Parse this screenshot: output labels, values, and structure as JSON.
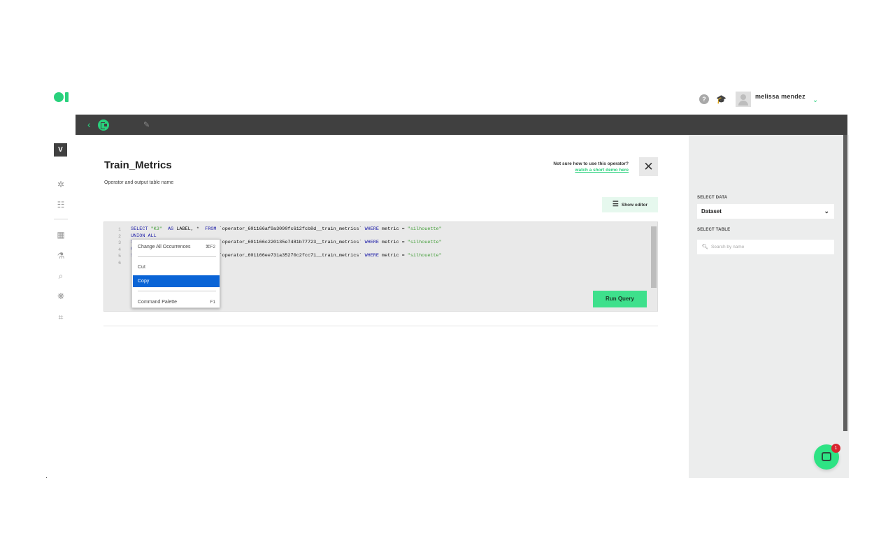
{
  "header": {
    "user_name": "melissa mendez",
    "icons": [
      "help-icon",
      "graduation-cap-icon",
      "avatar",
      "chevron-down-icon"
    ]
  },
  "sidebar": {
    "workspace_initial": "V",
    "items": [
      "flow-icon",
      "team-icon",
      "dashboard-icon",
      "experiments-icon",
      "analytics-icon",
      "models-icon",
      "code-icon"
    ]
  },
  "operator": {
    "title": "Train_Metrics",
    "subtitle": "Operator and output table name",
    "help_question": "Not sure how to use this operator?",
    "help_link": "watch a short demo here",
    "show_editor_label": "Show editor",
    "run_query_label": "Run Query"
  },
  "editor": {
    "line_numbers": [
      "1",
      "2",
      "3",
      "4",
      "5",
      "6"
    ],
    "lines": [
      "SELECT \"K3\"  AS LABEL, *  FROM `operator_601166af9a3090fc612fcb8d__train_metrics` WHERE metric = \"silhouette\"",
      "UNION ALL",
      "SELECT \"K4\"  AS LABEL, *  FROM `operator_601166c220135e7481b77723__train_metrics` WHERE metric = \"silhouette\"",
      "UNION ALL",
      "SELECT \"K5\"  AS LABEL, *  FROM `operator_601166ee731a35270c2fcc71__train_metrics` WHERE metric = \"silhouette\"",
      ""
    ]
  },
  "context_menu": {
    "items": [
      {
        "label": "Change All Occurrences",
        "shortcut": "⌘F2"
      },
      {
        "label": "Cut",
        "shortcut": ""
      },
      {
        "label": "Copy",
        "shortcut": ""
      },
      {
        "label": "Command Palette",
        "shortcut": "F1"
      }
    ],
    "selected": "Copy"
  },
  "right_panel": {
    "select_data_label": "SELECT DATA",
    "select_data_value": "Dataset",
    "select_table_label": "SELECT TABLE",
    "search_placeholder": "Search by name"
  },
  "chat": {
    "badge_count": "1"
  },
  "colors": {
    "accent": "#28d17c",
    "dark_bar": "#404040",
    "selection": "#0a64d6",
    "keyword": "#1a1aa6",
    "string": "#3f9c35",
    "badge": "#d9262f"
  }
}
